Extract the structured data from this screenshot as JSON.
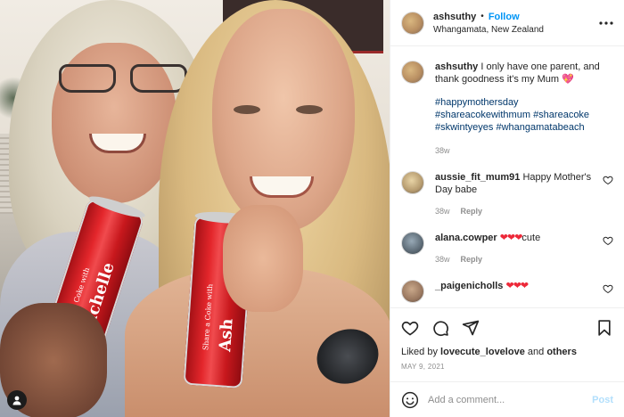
{
  "header": {
    "username": "ashsuthy",
    "separator": "•",
    "follow_label": "Follow",
    "location": "Whangamata, New Zealand"
  },
  "photo": {
    "can_left_line1": "Share a Coke with",
    "can_left_name": "Michelle",
    "can_right_line1": "Share a Coke with",
    "can_right_name": "Ash"
  },
  "caption": {
    "username": "ashsuthy",
    "text": "I only have one parent, and thank goodness it's my Mum",
    "emoji": "💖",
    "tags": [
      "#happymothersday",
      "#shareacokewithmum",
      "#shareacoke",
      "#skwintyeyes",
      "#whangamatabeach"
    ],
    "time": "38w"
  },
  "comments": [
    {
      "username": "aussie_fit_mum91",
      "text": "Happy Mother's Day babe",
      "time": "38w",
      "reply": "Reply"
    },
    {
      "username": "alana.cowper",
      "hearts": "❤❤❤",
      "text": "cute",
      "time": "38w",
      "reply": "Reply"
    },
    {
      "username": "_paigenicholls",
      "hearts": "❤❤❤"
    }
  ],
  "likes": {
    "prefix": "Liked by",
    "user": "lovecute_lovelove",
    "joiner": "and",
    "others": "others"
  },
  "date": "MAY 9, 2021",
  "add_comment": {
    "placeholder": "Add a comment...",
    "post_label": "Post"
  },
  "colors": {
    "accent": "#0095f6",
    "post_disabled": "#b2dffc",
    "hashtag": "#00376b",
    "heart_red": "#ed2939"
  }
}
